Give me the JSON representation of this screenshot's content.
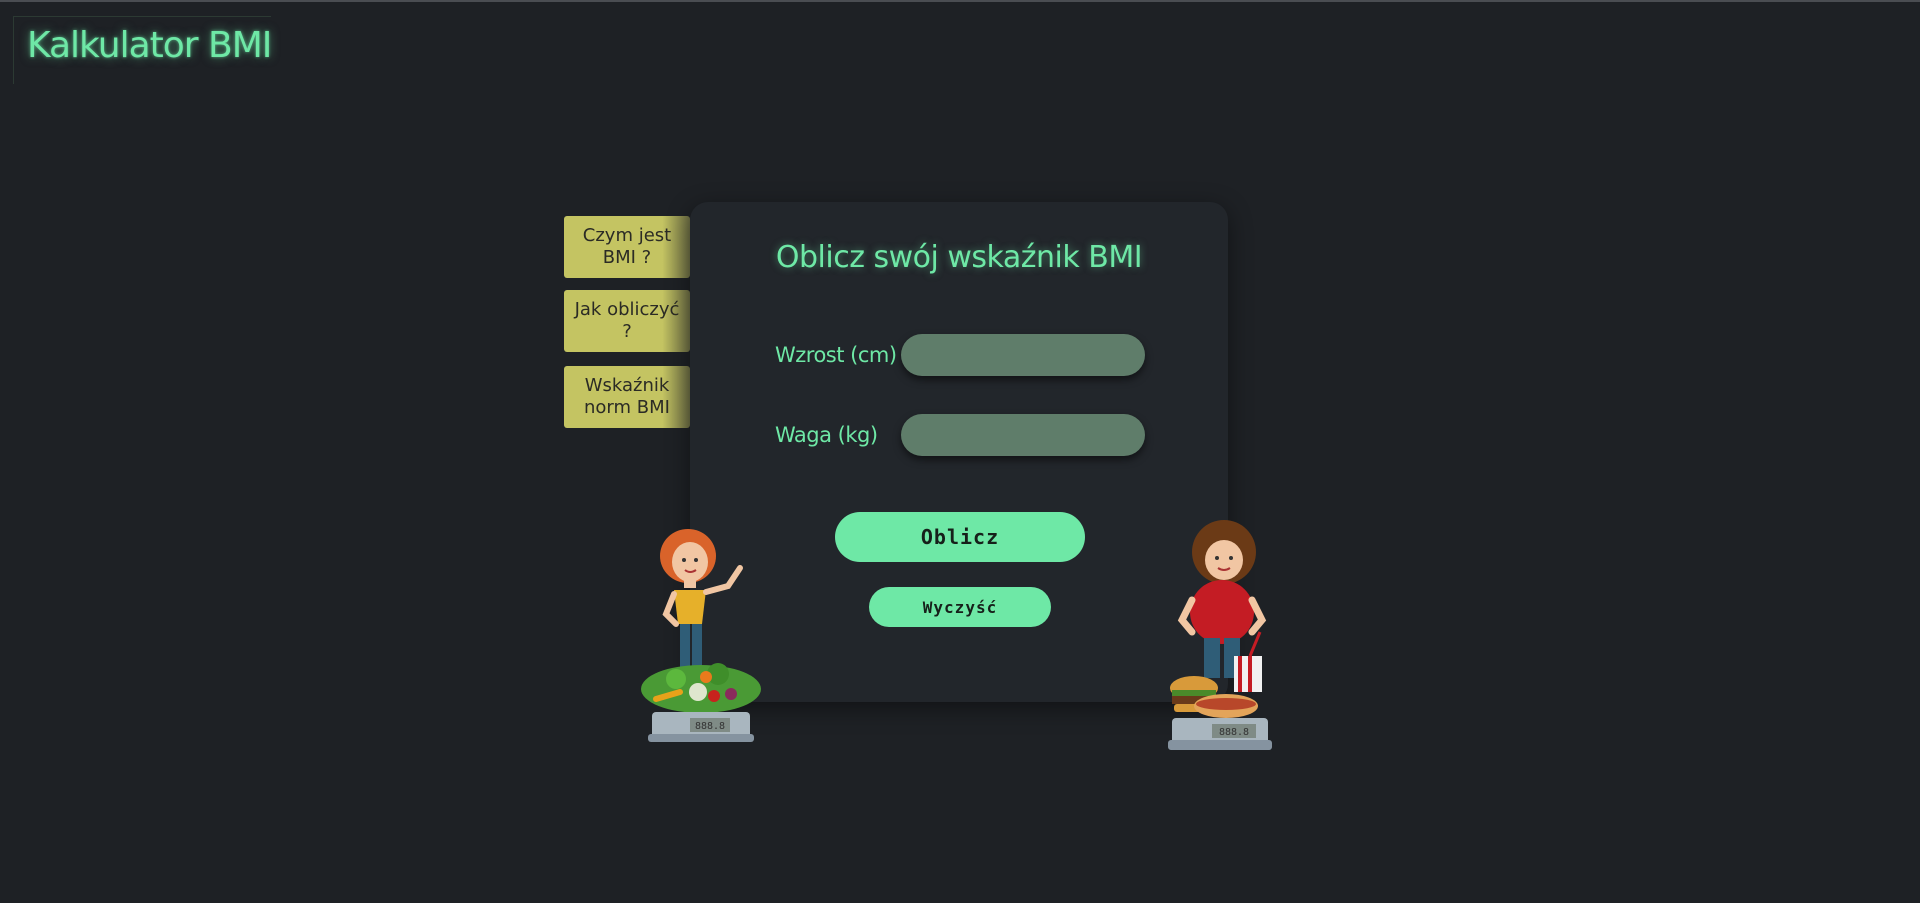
{
  "app": {
    "title": "Kalkulator BMI"
  },
  "sidebar": {
    "tabs": [
      {
        "label": "Czym jest BMI ?"
      },
      {
        "label": "Jak obliczyć ?"
      },
      {
        "label": "Wskaźnik norm BMI"
      }
    ]
  },
  "form": {
    "title": "Oblicz swój wskaźnik BMI",
    "height_label": "Wzrost (cm)",
    "height_value": "",
    "weight_label": "Waga (kg)",
    "weight_value": "",
    "calculate_label": "Oblicz",
    "clear_label": "Wyczyść"
  },
  "scales": {
    "left_display": "888.8",
    "right_display": "888.8"
  },
  "colors": {
    "background": "#1e2125",
    "accent": "#6ee8a6",
    "tab": "#c4c462",
    "card": "#22262b",
    "input": "#5f7d6a"
  },
  "icons": {
    "left_illustration": "slim-woman-vegetables-scale-icon",
    "right_illustration": "overweight-woman-fastfood-scale-icon"
  }
}
